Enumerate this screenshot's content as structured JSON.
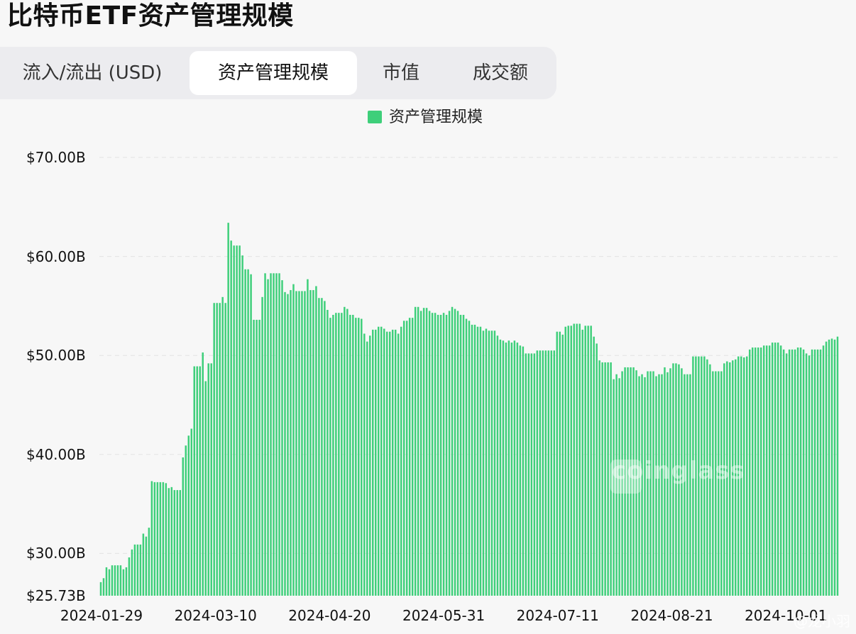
{
  "page": {
    "title": "比特币ETF资产管理规模"
  },
  "tabs": [
    {
      "label": "流入/流出 (USD)",
      "active": false
    },
    {
      "label": "资产管理规模",
      "active": true
    },
    {
      "label": "市值",
      "active": false
    },
    {
      "label": "成交额",
      "active": false
    }
  ],
  "watermark": {
    "text": "coinglass",
    "corner_text": "@龙小羽"
  },
  "colors": {
    "bar": "#3ecf7a",
    "grid": "#e3e3e3",
    "active_tab": "#ffffff"
  },
  "chart_data": {
    "type": "bar",
    "title": "",
    "legend": [
      "资产管理规模"
    ],
    "legend_position": "top-center",
    "y_unit": "USD (billions)",
    "ylim": [
      25.73,
      70
    ],
    "yticks": [
      {
        "value": 70,
        "label": "$70.00B"
      },
      {
        "value": 60,
        "label": "$60.00B"
      },
      {
        "value": 50,
        "label": "$50.00B"
      },
      {
        "value": 40,
        "label": "$40.00B"
      },
      {
        "value": 30,
        "label": "$30.00B"
      },
      {
        "value": 25.73,
        "label": "$25.73B"
      }
    ],
    "xticks": [
      "2024-01-29",
      "2024-03-10",
      "2024-04-20",
      "2024-05-31",
      "2024-07-11",
      "2024-08-21",
      "2024-10-01"
    ],
    "grid": true,
    "series": [
      {
        "name": "资产管理规模",
        "values": [
          27.1,
          27.5,
          28.6,
          28.4,
          28.8,
          28.8,
          28.8,
          28.8,
          28.4,
          28.6,
          29.6,
          30.4,
          30.9,
          30.9,
          30.9,
          32.0,
          31.7,
          32.6,
          37.3,
          37.2,
          37.2,
          37.2,
          37.2,
          37.1,
          36.6,
          36.7,
          36.4,
          36.4,
          36.4,
          39.7,
          40.9,
          41.9,
          42.6,
          48.9,
          48.9,
          48.9,
          50.3,
          47.4,
          49.2,
          49.2,
          55.3,
          55.3,
          55.3,
          55.9,
          55.3,
          63.4,
          61.6,
          61.1,
          61.1,
          61.1,
          60.1,
          58.7,
          58.7,
          58.2,
          53.6,
          53.6,
          53.6,
          55.9,
          58.3,
          57.7,
          58.3,
          58.3,
          58.3,
          58.3,
          57.6,
          56.4,
          56.2,
          56.6,
          57.2,
          56.5,
          56.5,
          56.5,
          56.5,
          57.7,
          56.6,
          56.6,
          57.0,
          55.8,
          55.8,
          55.5,
          54.6,
          53.8,
          54.1,
          54.3,
          54.3,
          54.3,
          54.9,
          54.7,
          54.1,
          54.1,
          53.8,
          53.8,
          53.7,
          52.2,
          51.4,
          52.0,
          52.6,
          52.6,
          52.9,
          52.9,
          52.7,
          52.4,
          52.4,
          52.6,
          52.6,
          52.2,
          52.9,
          53.5,
          53.5,
          53.8,
          53.8,
          54.9,
          54.9,
          54.5,
          54.8,
          54.8,
          54.5,
          54.3,
          54.3,
          54.1,
          54.1,
          54.3,
          54.1,
          54.5,
          54.9,
          54.7,
          54.5,
          54.1,
          54.1,
          53.7,
          53.5,
          53.1,
          53.1,
          52.9,
          52.9,
          52.5,
          52.7,
          52.5,
          52.5,
          52.5,
          52.0,
          51.6,
          51.5,
          51.3,
          51.5,
          51.3,
          51.5,
          51.3,
          51.0,
          50.9,
          50.2,
          50.2,
          50.2,
          50.2,
          50.5,
          50.5,
          50.5,
          50.5,
          50.5,
          50.5,
          50.5,
          52.4,
          52.4,
          52.1,
          52.9,
          53.0,
          53.0,
          53.2,
          53.2,
          53.2,
          52.6,
          53.0,
          53.0,
          53.0,
          51.9,
          51.2,
          49.5,
          49.3,
          49.3,
          49.3,
          49.3,
          47.6,
          48.1,
          47.7,
          48.4,
          48.8,
          48.8,
          48.8,
          48.8,
          48.5,
          47.9,
          48.1,
          47.8,
          48.4,
          48.4,
          48.4,
          47.9,
          48.1,
          48.1,
          48.8,
          48.3,
          48.7,
          49.2,
          49.2,
          49.1,
          48.7,
          48.1,
          48.1,
          48.1,
          49.9,
          49.9,
          49.9,
          49.9,
          49.9,
          49.6,
          49.1,
          48.4,
          48.4,
          48.4,
          48.4,
          49.2,
          49.4,
          49.3,
          49.5,
          49.6,
          49.9,
          49.9,
          49.8,
          49.9,
          50.6,
          50.8,
          50.8,
          50.8,
          50.8,
          51.0,
          51.0,
          51.0,
          51.3,
          51.3,
          51.3,
          51.0,
          50.6,
          50.2,
          50.6,
          50.6,
          50.6,
          50.8,
          50.8,
          50.6,
          50.2,
          50.0,
          50.6,
          50.6,
          50.6,
          50.6,
          51.0,
          51.4,
          51.6,
          51.7,
          51.6,
          51.9
        ]
      }
    ]
  }
}
